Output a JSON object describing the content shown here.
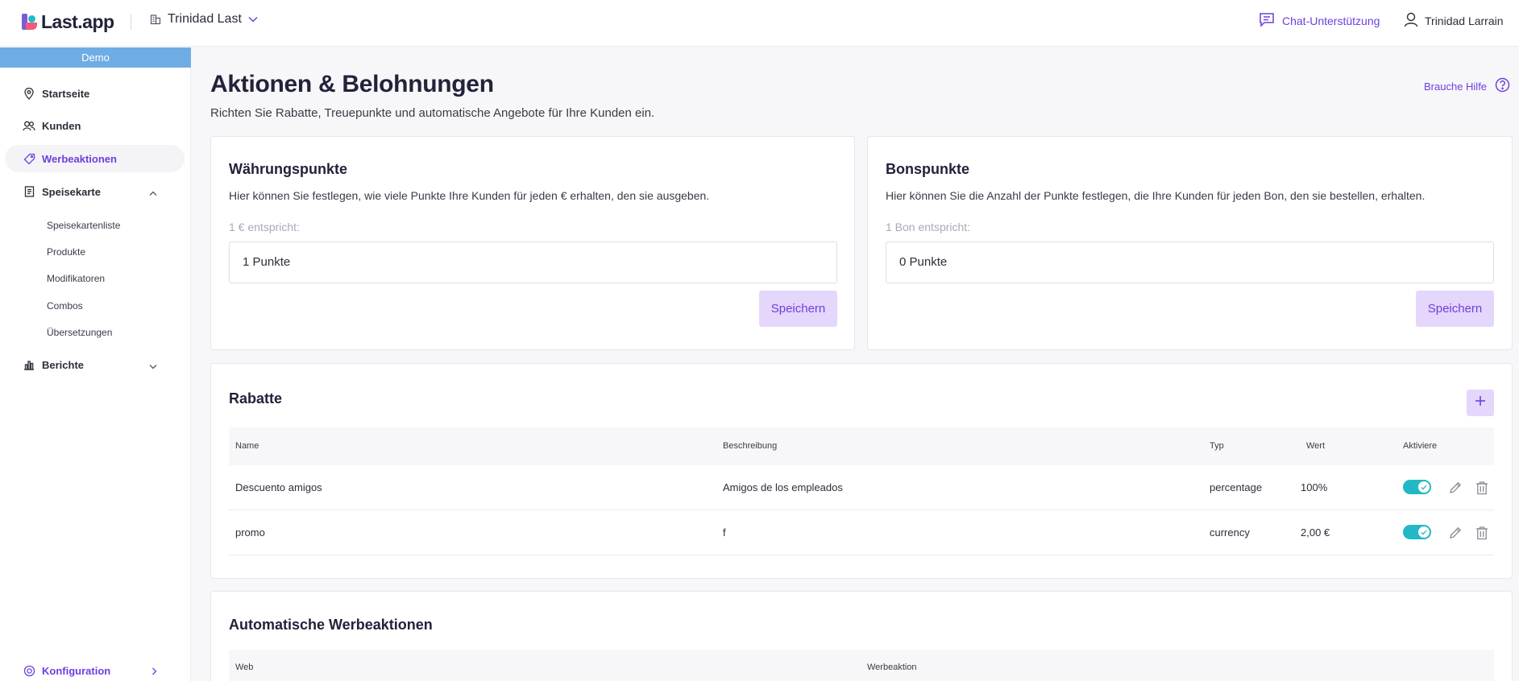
{
  "topbar": {
    "logo_text": "Last.app",
    "store_name": "Trinidad Last",
    "chat_label": "Chat-Unterstützung",
    "user_name": "Trinidad Larrain"
  },
  "sidebar": {
    "demo_label": "Demo",
    "items": [
      {
        "label": "Startseite",
        "icon": "location-pin-icon"
      },
      {
        "label": "Kunden",
        "icon": "users-icon"
      },
      {
        "label": "Werbeaktionen",
        "icon": "tag-icon"
      },
      {
        "label": "Speisekarte",
        "icon": "menu-book-icon"
      },
      {
        "label": "Berichte",
        "icon": "bar-chart-icon"
      },
      {
        "label": "Konfiguration",
        "icon": "settings-icon"
      }
    ],
    "sub_items": [
      "Speisekartenliste",
      "Produkte",
      "Modifikatoren",
      "Combos",
      "Übersetzungen"
    ]
  },
  "page": {
    "title": "Aktionen & Belohnungen",
    "subtitle": "Richten Sie Rabatte, Treuepunkte und automatische Angebote für Ihre Kunden ein.",
    "help_label": "Brauche Hilfe"
  },
  "currency_points": {
    "title": "Währungspunkte",
    "description": "Hier können Sie festlegen, wie viele Punkte Ihre Kunden für jeden € erhalten, den sie ausgeben.",
    "field_label": "1 € entspricht:",
    "value": "1 Punkte",
    "save_label": "Speichern"
  },
  "bon_points": {
    "title": "Bonspunkte",
    "description": "Hier können Sie die Anzahl der Punkte festlegen, die Ihre Kunden für jeden Bon, den sie bestellen, erhalten.",
    "field_label": "1 Bon entspricht:",
    "value": "0 Punkte",
    "save_label": "Speichern"
  },
  "discounts": {
    "title": "Rabatte",
    "columns": [
      "Name",
      "Beschreibung",
      "Typ",
      "Wert",
      "Aktiviere"
    ],
    "rows": [
      {
        "name": "Descuento amigos",
        "description": "Amigos de los empleados",
        "type": "percentage",
        "value": "100%",
        "active": true
      },
      {
        "name": "promo",
        "description": "f",
        "type": "currency",
        "value": "2,00 €",
        "active": true
      }
    ]
  },
  "auto_promotions": {
    "title": "Automatische Werbeaktionen",
    "columns": [
      "Web",
      "Werbeaktion"
    ]
  },
  "colors": {
    "accent": "#6d3fe0",
    "accent_light": "#e5d6fb",
    "toggle_on": "#22b8c5",
    "demo_bar": "#70ace4"
  }
}
